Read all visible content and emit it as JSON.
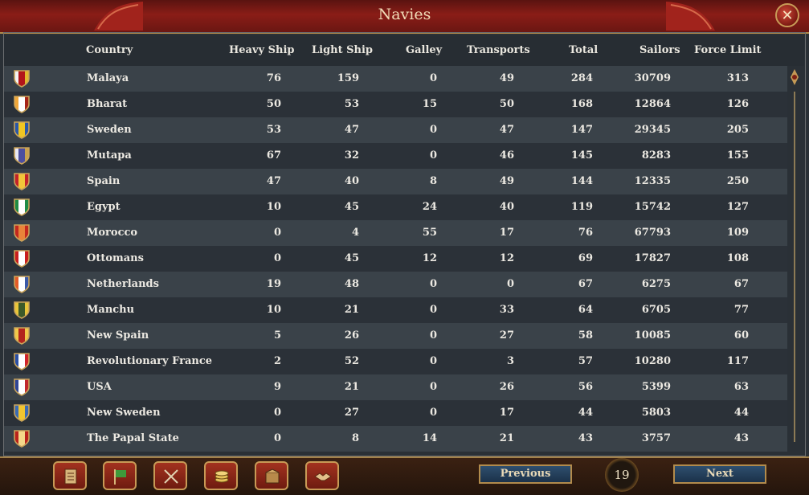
{
  "window": {
    "title": "Navies",
    "close_symbol": "✕"
  },
  "columns": [
    "Country",
    "Heavy Ship",
    "Light Ship",
    "Galley",
    "Transports",
    "Total",
    "Sailors",
    "Force Limit"
  ],
  "rows": [
    {
      "country": "Malaya",
      "heavy": "76",
      "light": "159",
      "galley": "0",
      "transports": "49",
      "total": "284",
      "sailors": "30709",
      "force_limit": "313",
      "flag_colors": [
        "#f3f3f3",
        "#b3151a",
        "#e2b92d"
      ]
    },
    {
      "country": "Bharat",
      "heavy": "50",
      "light": "53",
      "galley": "15",
      "transports": "50",
      "total": "168",
      "sailors": "12864",
      "force_limit": "126",
      "flag_colors": [
        "#f0a73a",
        "#ffffff",
        "#a62418"
      ]
    },
    {
      "country": "Sweden",
      "heavy": "53",
      "light": "47",
      "galley": "0",
      "transports": "47",
      "total": "147",
      "sailors": "29345",
      "force_limit": "205",
      "flag_colors": [
        "#2a57a8",
        "#f0c623",
        "#2a57a8"
      ]
    },
    {
      "country": "Mutapa",
      "heavy": "67",
      "light": "32",
      "galley": "0",
      "transports": "46",
      "total": "145",
      "sailors": "8283",
      "force_limit": "155",
      "flag_colors": [
        "#e8e8f4",
        "#4d4f9f",
        "#c9a24d"
      ]
    },
    {
      "country": "Spain",
      "heavy": "47",
      "light": "40",
      "galley": "8",
      "transports": "49",
      "total": "144",
      "sailors": "12335",
      "force_limit": "250",
      "flag_colors": [
        "#c2222a",
        "#f2c53a",
        "#c2222a"
      ]
    },
    {
      "country": "Egypt",
      "heavy": "10",
      "light": "45",
      "galley": "24",
      "transports": "40",
      "total": "119",
      "sailors": "15742",
      "force_limit": "127",
      "flag_colors": [
        "#1e8b45",
        "#ffffff",
        "#1e8b45"
      ]
    },
    {
      "country": "Morocco",
      "heavy": "0",
      "light": "4",
      "galley": "55",
      "transports": "17",
      "total": "76",
      "sailors": "67793",
      "force_limit": "109",
      "flag_colors": [
        "#c3281e",
        "#e9843a",
        "#c3281e"
      ]
    },
    {
      "country": "Ottomans",
      "heavy": "0",
      "light": "45",
      "galley": "12",
      "transports": "12",
      "total": "69",
      "sailors": "17827",
      "force_limit": "108",
      "flag_colors": [
        "#c81d1e",
        "#ffffff",
        "#c81d1e"
      ]
    },
    {
      "country": "Netherlands",
      "heavy": "19",
      "light": "48",
      "galley": "0",
      "transports": "0",
      "total": "67",
      "sailors": "6275",
      "force_limit": "67",
      "flag_colors": [
        "#e25b28",
        "#ffffff",
        "#3a59a7"
      ]
    },
    {
      "country": "Manchu",
      "heavy": "10",
      "light": "21",
      "galley": "0",
      "transports": "33",
      "total": "64",
      "sailors": "6705",
      "force_limit": "77",
      "flag_colors": [
        "#e9c53a",
        "#3d5a2a",
        "#e9c53a"
      ]
    },
    {
      "country": "New Spain",
      "heavy": "5",
      "light": "26",
      "galley": "0",
      "transports": "27",
      "total": "58",
      "sailors": "10085",
      "force_limit": "60",
      "flag_colors": [
        "#f1c94a",
        "#b3251d",
        "#f1c94a"
      ]
    },
    {
      "country": "Revolutionary France",
      "heavy": "2",
      "light": "52",
      "galley": "0",
      "transports": "3",
      "total": "57",
      "sailors": "10280",
      "force_limit": "117",
      "flag_colors": [
        "#2b4fa5",
        "#ffffff",
        "#d0232b"
      ]
    },
    {
      "country": "USA",
      "heavy": "9",
      "light": "21",
      "galley": "0",
      "transports": "26",
      "total": "56",
      "sailors": "5399",
      "force_limit": "63",
      "flag_colors": [
        "#2f4596",
        "#ffffff",
        "#c1272d"
      ]
    },
    {
      "country": "New Sweden",
      "heavy": "0",
      "light": "27",
      "galley": "0",
      "transports": "17",
      "total": "44",
      "sailors": "5803",
      "force_limit": "44",
      "flag_colors": [
        "#3a6ab3",
        "#f1c530",
        "#3a6ab3"
      ]
    },
    {
      "country": "The Papal State",
      "heavy": "0",
      "light": "8",
      "galley": "14",
      "transports": "21",
      "total": "43",
      "sailors": "3757",
      "force_limit": "43",
      "flag_colors": [
        "#b9221c",
        "#f4d88a",
        "#b9221c"
      ]
    }
  ],
  "footer": {
    "buttons": [
      {
        "name": "ledger-icon"
      },
      {
        "name": "flag-icon"
      },
      {
        "name": "crossed-swords-icon"
      },
      {
        "name": "coins-icon"
      },
      {
        "name": "trade-goods-icon"
      },
      {
        "name": "handshake-icon"
      }
    ],
    "previous_label": "Previous",
    "next_label": "Next",
    "page_number": "19"
  }
}
